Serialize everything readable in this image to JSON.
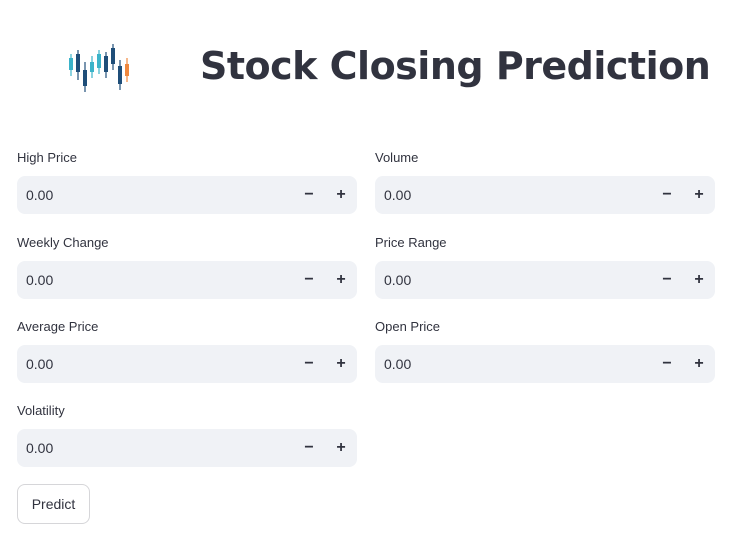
{
  "header": {
    "logo_icon": "candlestick-chart-icon",
    "title": "Stock Closing Prediction"
  },
  "colors": {
    "input_bg": "#f0f2f6",
    "text": "#31333f",
    "candle_teal": "#3bb3c9",
    "candle_navy": "#1f4e79",
    "candle_orange": "#f0883e"
  },
  "form": {
    "fields": [
      {
        "label": "High Price",
        "value": "0.00"
      },
      {
        "label": "Volume",
        "value": "0.00"
      },
      {
        "label": "Weekly Change",
        "value": "0.00"
      },
      {
        "label": "Price Range",
        "value": "0.00"
      },
      {
        "label": "Average Price",
        "value": "0.00"
      },
      {
        "label": "Open Price",
        "value": "0.00"
      },
      {
        "label": "Volatility",
        "value": "0.00"
      }
    ],
    "minus_symbol": "−",
    "plus_symbol": "+",
    "predict_label": "Predict"
  }
}
